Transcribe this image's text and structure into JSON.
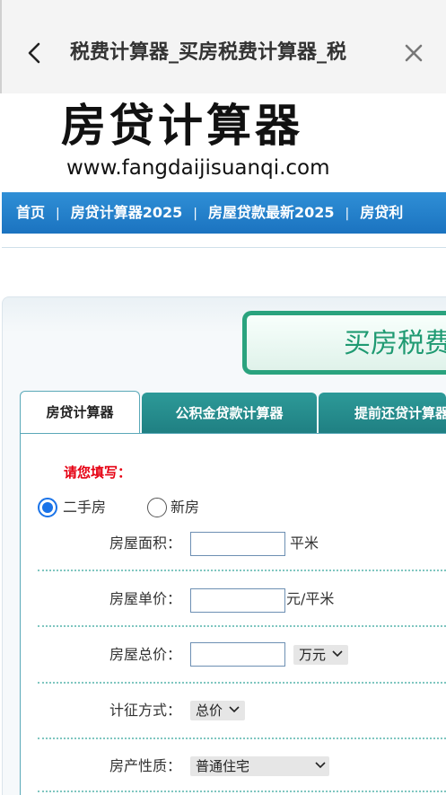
{
  "appbar": {
    "title": "税费计算器_买房税费计算器_税",
    "back_icon": "chevron-left-icon",
    "close_icon": "close-icon"
  },
  "site": {
    "logo_text": "房贷计算器",
    "url": "www.fangdaijisuanqi.com"
  },
  "nav": {
    "items": [
      "首页",
      "房贷计算器2025",
      "房屋贷款最新2025",
      "房贷利"
    ],
    "separator": "|"
  },
  "banner": {
    "text": "买房税费"
  },
  "tabs": [
    {
      "label": "房贷计算器",
      "active": true
    },
    {
      "label": "公积金贷款计算器",
      "active": false
    },
    {
      "label": "提前还贷计算器",
      "active": false
    }
  ],
  "form": {
    "prompt": "请您填写：",
    "house_type": {
      "options": [
        "二手房",
        "新房"
      ],
      "selected": "二手房"
    },
    "area": {
      "label": "房屋面积：",
      "value": "",
      "unit": "平米"
    },
    "unit_price": {
      "label": "房屋单价：",
      "value": "",
      "unit": "元/平米"
    },
    "total_price": {
      "label": "房屋总价：",
      "value": "",
      "unit_select": "万元"
    },
    "levy_method": {
      "label": "计征方式：",
      "selected": "总价"
    },
    "property_nature": {
      "label": "房产性质：",
      "selected": "普通住宅"
    }
  },
  "colors": {
    "nav_bg": "#1b73c0",
    "tab_bg": "#1f7f82",
    "banner_border": "#2aa37e",
    "prompt": "#e60012",
    "radio_checked": "#1a73e8"
  }
}
